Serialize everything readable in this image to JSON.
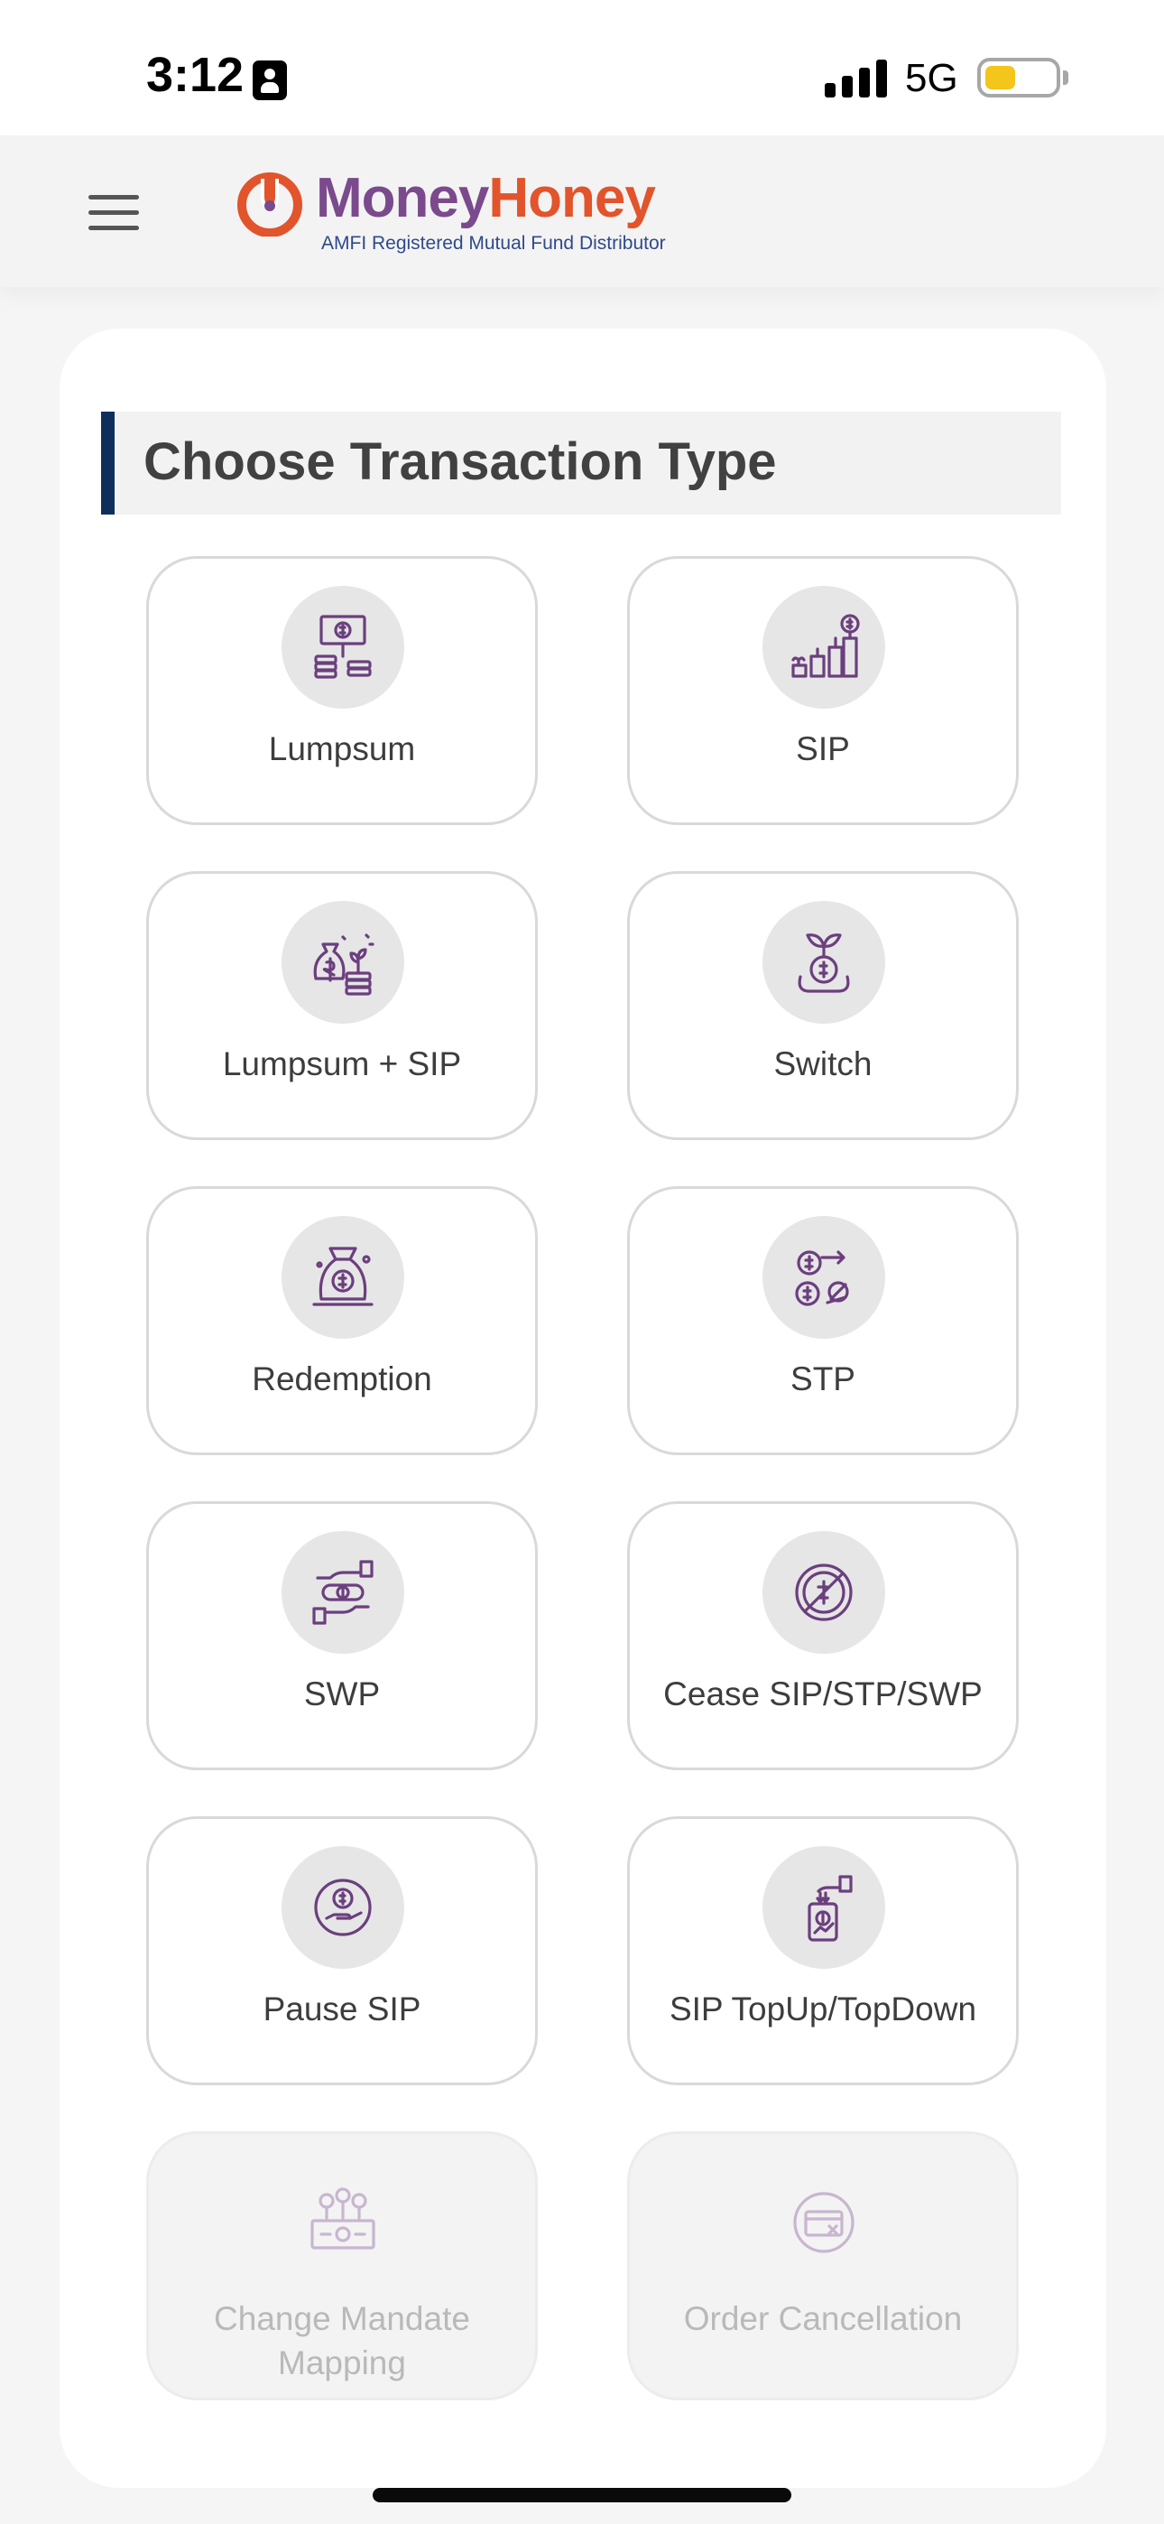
{
  "status_bar": {
    "time": "3:12",
    "network": "5G",
    "battery_level": 0.45,
    "signal_bars": 4,
    "icons": [
      "id-card-icon",
      "signal-icon",
      "battery-icon"
    ]
  },
  "header": {
    "menu_icon": "hamburger-icon",
    "logo": {
      "brand_part1": "Money",
      "brand_part2": "Honey",
      "tagline": "AMFI Registered Mutual Fund Distributor",
      "colors": {
        "money": "#7a4a8c",
        "honey": "#e2542b",
        "mark": "#e2542b"
      }
    }
  },
  "main": {
    "title": "Choose Transaction Type",
    "title_accent": "#0f2f5a",
    "icon_color": "#6b3f7e",
    "options": [
      {
        "label": "Lumpsum",
        "icon": "money-stack-icon",
        "enabled": true
      },
      {
        "label": "SIP",
        "icon": "growing-coins-icon",
        "enabled": true
      },
      {
        "label": "Lumpsum + SIP",
        "icon": "money-bag-plant-icon",
        "enabled": true
      },
      {
        "label": "Switch",
        "icon": "plant-coin-icon",
        "enabled": true
      },
      {
        "label": "Redemption",
        "icon": "coin-bag-icon",
        "enabled": true
      },
      {
        "label": "STP",
        "icon": "coin-transfer-icon",
        "enabled": true
      },
      {
        "label": "SWP",
        "icon": "hand-money-icon",
        "enabled": true
      },
      {
        "label": "Cease SIP/STP/SWP",
        "icon": "no-money-icon",
        "enabled": true
      },
      {
        "label": "Pause SIP",
        "icon": "pause-coin-icon",
        "enabled": true
      },
      {
        "label": "SIP TopUp/TopDown",
        "icon": "phone-topup-icon",
        "enabled": true
      },
      {
        "label": "Change Mandate Mapping",
        "icon": "banknote-coins-icon",
        "enabled": false
      },
      {
        "label": "Order Cancellation",
        "icon": "card-cancel-icon",
        "enabled": false
      }
    ]
  }
}
